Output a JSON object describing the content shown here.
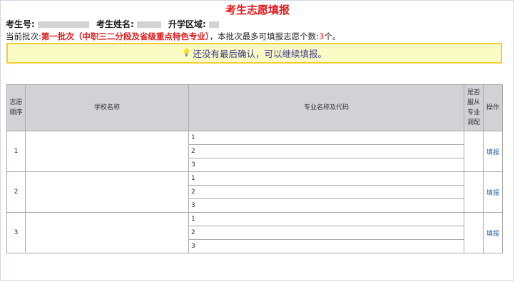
{
  "page": {
    "title": "考生志愿填报",
    "exam_no_label": "考生号:",
    "name_label": "考生姓名:",
    "region_label": "升学区域:"
  },
  "batch": {
    "prefix": "当前批次:",
    "name": "第一批次（中职三二分段及省级重点特色专业）",
    "middle": "，本批次最多可填报志愿个数:",
    "max_count": "3",
    "suffix": "个。"
  },
  "notice": {
    "icon": "lightbulb-icon",
    "text": "还没有最后确认，可以继续填报。"
  },
  "table": {
    "headers": {
      "order": "志愿顺序",
      "school": "学校名称",
      "major": "专业名称及代码",
      "adjust": "是否服从专业调配",
      "action": "操作"
    },
    "rows": [
      {
        "order": "1",
        "majors": [
          "1",
          "2",
          "3"
        ],
        "action": "填报"
      },
      {
        "order": "2",
        "majors": [
          "1",
          "2",
          "3"
        ],
        "action": "填报"
      },
      {
        "order": "3",
        "majors": [
          "1",
          "2",
          "3"
        ],
        "action": "填报"
      }
    ]
  }
}
